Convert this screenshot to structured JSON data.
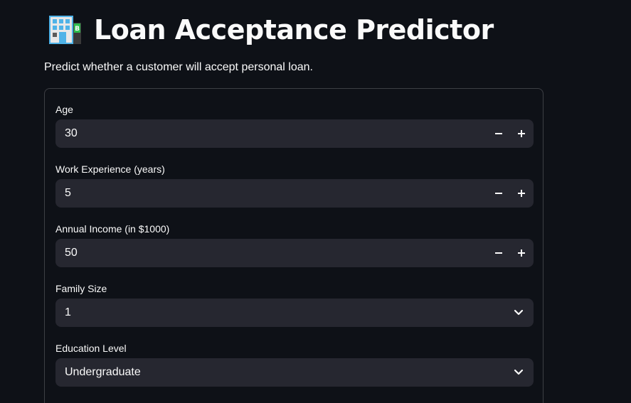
{
  "app": {
    "title": "Loan Acceptance Predictor",
    "title_icon": "bank-building-icon",
    "subtitle": "Predict whether a customer will accept personal loan."
  },
  "form": {
    "age": {
      "label": "Age",
      "value": "30"
    },
    "experience": {
      "label": "Work Experience (years)",
      "value": "5"
    },
    "income": {
      "label": "Annual Income (in $1000)",
      "value": "50"
    },
    "family": {
      "label": "Family Size",
      "value": "1"
    },
    "education": {
      "label": "Education Level",
      "value": "Undergraduate"
    }
  },
  "colors": {
    "background": "#0e1117",
    "input_background": "#262730",
    "text": "#fafafa",
    "border": "#3d4048"
  }
}
